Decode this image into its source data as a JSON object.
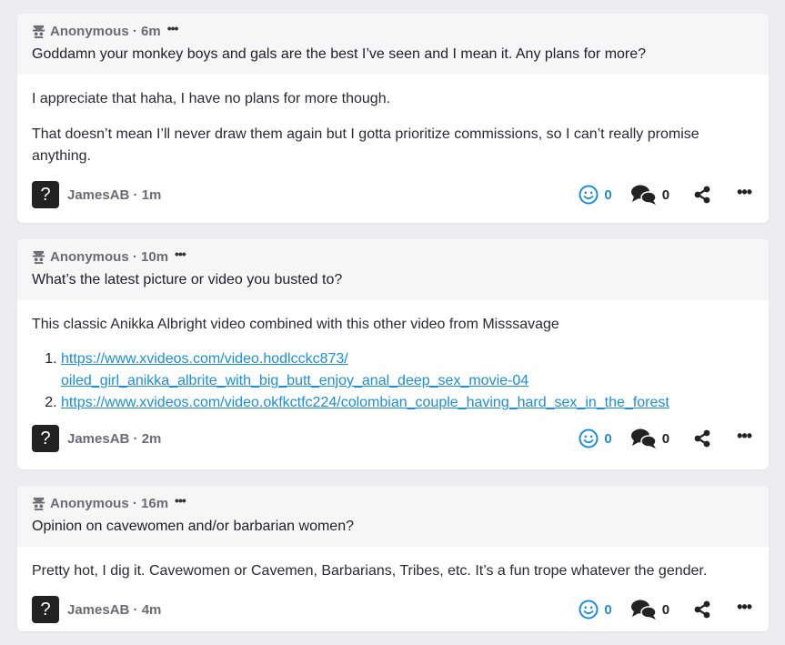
{
  "colors": {
    "background": "#ededf1",
    "card": "#ffffff",
    "question_bg": "#f6f6f7",
    "accent": "#1b8fd6",
    "muted": "#6b6b73"
  },
  "posts": [
    {
      "asker": "Anonymous",
      "asked_time": "6m",
      "question": "Goddamn your monkey boys and gals are the best I’ve seen and I mean it. Any plans for more?",
      "answer_paragraphs": [
        "I appreciate that haha, I have no plans for more though.",
        "That doesn’t mean I’ll never draw them again but I gotta prioritize commissions, so I can’t really promise anything."
      ],
      "author": "JamesAB",
      "answer_time": "1m",
      "reactions": "0",
      "comments": "0"
    },
    {
      "asker": "Anonymous",
      "asked_time": "10m",
      "question": "What’s the latest picture or video you busted to?",
      "answer_paragraphs": [
        "This classic Anikka Albright video combined with this other video from Misssavage"
      ],
      "links": [
        "https://www.xvideos.com/video.hodlcckc873/ oiled_girl_anikka_albrite_with_big_butt_enjoy_anal_deep_sex_movie-04",
        "https://www.xvideos.com/video.okfkctfc224/colombian_couple_having_hard_sex_in_the_forest"
      ],
      "author": "JamesAB",
      "answer_time": "2m",
      "reactions": "0",
      "comments": "0"
    },
    {
      "asker": "Anonymous",
      "asked_time": "16m",
      "question": "Opinion on cavewomen and/or barbarian women?",
      "answer_paragraphs": [
        "Pretty hot, I dig it. Cavewomen or Cavemen, Barbarians, Tribes, etc. It’s a fun trope whatever the gender."
      ],
      "author": "JamesAB",
      "answer_time": "4m",
      "reactions": "0",
      "comments": "0"
    }
  ],
  "icons": {
    "anon": "anonymous-mask-icon",
    "react": "smiley-face-icon",
    "comment": "chat-bubbles-icon",
    "share": "share-icon",
    "more": "more-dots-icon",
    "avatar": "question-mark-avatar"
  },
  "avatar_glyph": "?",
  "dots_glyph": "•••"
}
